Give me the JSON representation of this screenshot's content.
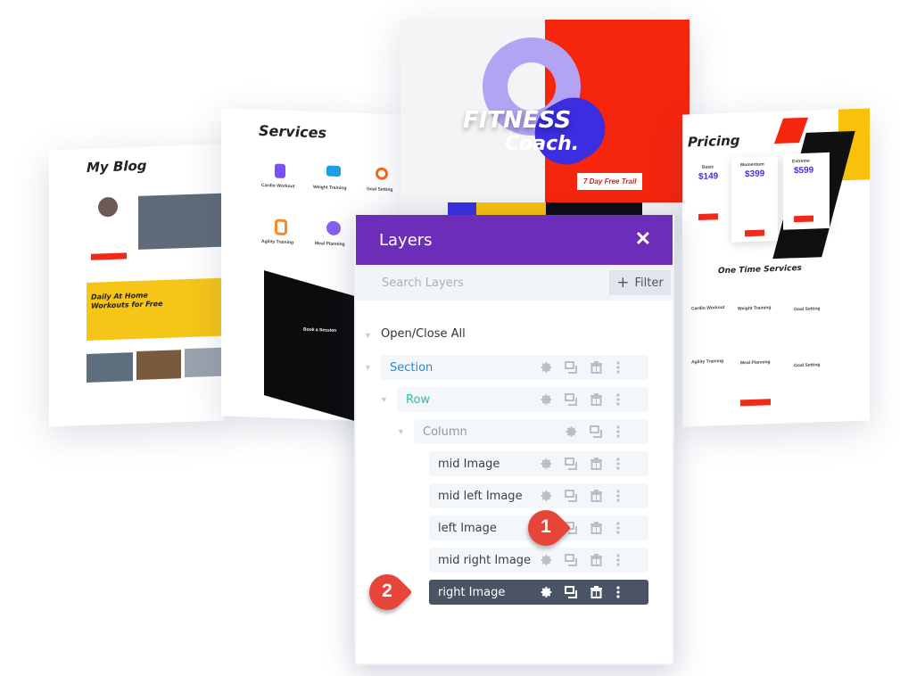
{
  "background": {
    "blog": {
      "title": "My Blog",
      "banner": "Daily At Home Workouts for Free"
    },
    "services": {
      "title": "Services",
      "items": [
        "Cardio Workout",
        "Weight Training",
        "Goal Setting",
        "Agility Training",
        "Meal Planning"
      ],
      "form_title": "Book a Session"
    },
    "fitness": {
      "title1": "FITNESS",
      "title2": "Coach.",
      "button": "7 Day Free Trail"
    },
    "pricing": {
      "title": "Pricing",
      "plans": [
        {
          "name": "Basic",
          "price": "$149"
        },
        {
          "name": "Momentum",
          "price": "$399"
        },
        {
          "name": "Extreme",
          "price": "$599"
        }
      ],
      "subtitle": "One Time Services",
      "items": [
        "Cardio Workout",
        "Weight Training",
        "Goal Setting",
        "Agility Training",
        "Meal Planning",
        "Goal Setting"
      ]
    }
  },
  "layers": {
    "title": "Layers",
    "search_placeholder": "Search Layers",
    "filter_label": "Filter",
    "open_close_all": "Open/Close All",
    "items": [
      {
        "label": "Section",
        "color": "#2b87da"
      },
      {
        "label": "Row",
        "color": "#29c4a9"
      },
      {
        "label": "Column",
        "color": "#8f98a3"
      },
      {
        "label": "mid Image"
      },
      {
        "label": "mid left Image"
      },
      {
        "label": "left Image"
      },
      {
        "label": "mid right Image"
      },
      {
        "label": "right Image",
        "selected": true
      }
    ]
  },
  "markers": [
    "1",
    "2"
  ],
  "colors": {
    "header": "#6c2eb9",
    "selected_row": "#4a5464",
    "marker": "#e8453a"
  }
}
